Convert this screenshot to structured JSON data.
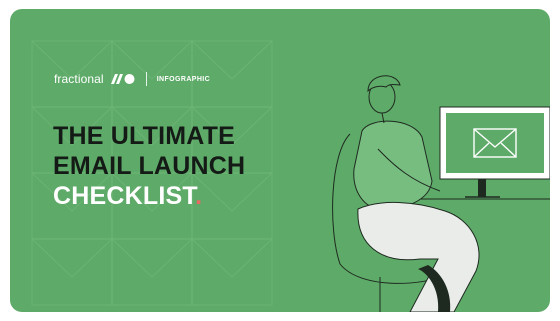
{
  "brand": {
    "name": "fractional",
    "tag": "INFOGRAPHIC",
    "logo_icon": "fractional-logo-icon"
  },
  "headline": {
    "line1": "THE ULTIMATE",
    "line2": "EMAIL LAUNCH",
    "line3": "CHECKLIST",
    "dot": "."
  },
  "colors": {
    "background": "#5eaa68",
    "headline_dark": "#141a15",
    "headline_light": "#ffffff",
    "accent_dot": "#e86b62"
  },
  "illustration": {
    "subject": "person-at-computer",
    "screen_icon": "envelope-icon"
  }
}
